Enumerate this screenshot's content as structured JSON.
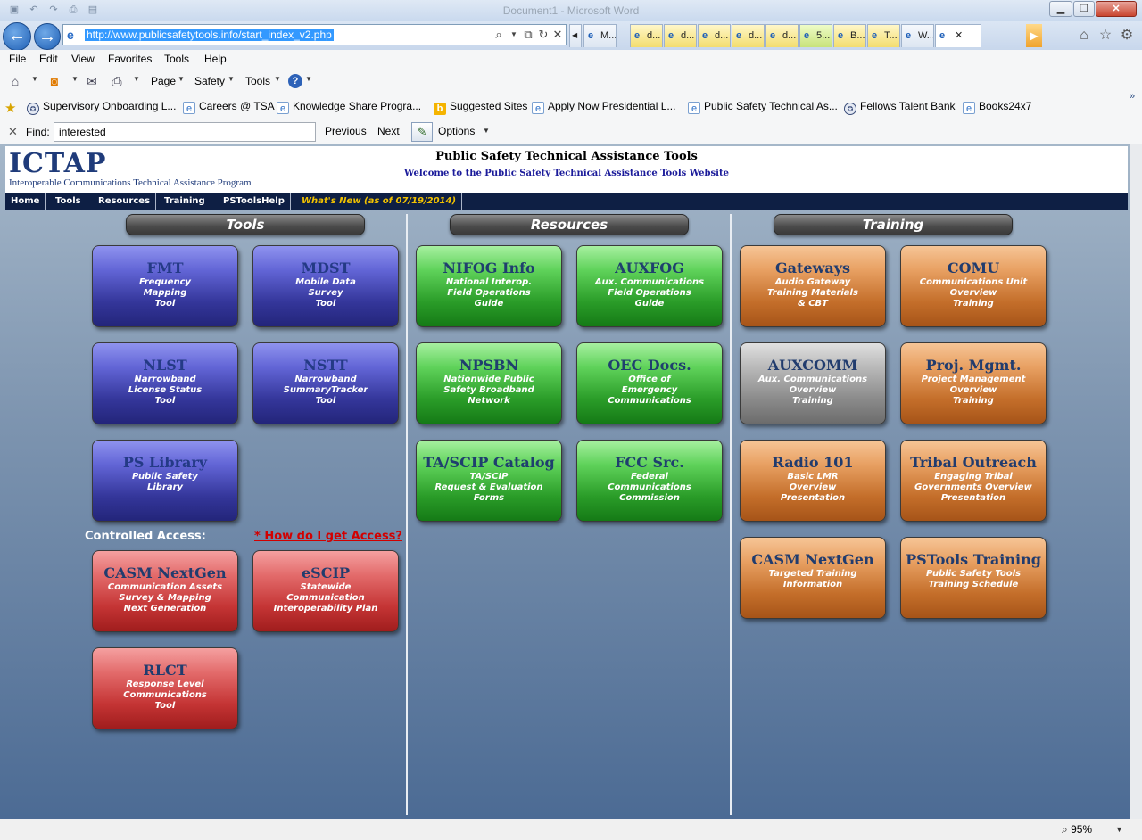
{
  "browser": {
    "window_title": "Document1 - Microsoft Word",
    "address_url": "http://www.publicsafetytools.info/start_index_v2.php",
    "tabs": [
      {
        "label": "M...",
        "style": "n"
      },
      {
        "label": "d...",
        "style": "y"
      },
      {
        "label": "d...",
        "style": "y"
      },
      {
        "label": "d...",
        "style": "y"
      },
      {
        "label": "d...",
        "style": "y"
      },
      {
        "label": "d...",
        "style": "y"
      },
      {
        "label": "5...",
        "style": "g"
      },
      {
        "label": "B...",
        "style": "y"
      },
      {
        "label": "T...",
        "style": "y"
      },
      {
        "label": "W...",
        "style": "n"
      },
      {
        "label": "",
        "style": "active"
      }
    ],
    "menu": [
      "File",
      "Edit",
      "View",
      "Favorites",
      "Tools",
      "Help"
    ],
    "command_bar": {
      "page": "Page",
      "safety": "Safety",
      "tools": "Tools"
    },
    "favorites": [
      {
        "label": "Supervisory Onboarding L...",
        "icon": "seal"
      },
      {
        "label": "Careers @ TSA",
        "icon": "ie"
      },
      {
        "label": "Knowledge Share Progra...",
        "icon": "ie"
      },
      {
        "label": "Suggested Sites",
        "icon": "bing"
      },
      {
        "label": "Apply Now  Presidential L...",
        "icon": "ie"
      },
      {
        "label": "Public Safety Technical As...",
        "icon": "ie"
      },
      {
        "label": "Fellows Talent Bank",
        "icon": "seal"
      },
      {
        "label": "Books24x7",
        "icon": "ie"
      }
    ],
    "find": {
      "label": "Find:",
      "value": "interested",
      "previous": "Previous",
      "next": "Next",
      "options": "Options"
    },
    "zoom": "95%"
  },
  "site": {
    "logo": "ICTAP",
    "logo_sub": "Interoperable Communications Technical Assistance Program",
    "title": "Public Safety Technical Assistance Tools",
    "welcome": "Welcome to the Public Safety Technical Assistance Tools Website",
    "nav": [
      "Home",
      "Tools",
      "Resources",
      "Training",
      "PSToolsHelp"
    ],
    "whats_new": "What's New (as of 07/19/2014)"
  },
  "sections": {
    "tools": "Tools",
    "resources": "Resources",
    "training": "Training"
  },
  "controlled_access": {
    "label": "Controlled Access:",
    "link": "* How do I get Access?"
  },
  "tools": [
    {
      "title": "FMT",
      "desc": "Frequency\nMapping\nTool"
    },
    {
      "title": "MDST",
      "desc": "Mobile Data\nSurvey\nTool"
    },
    {
      "title": "NLST",
      "desc": "Narrowband\nLicense Status\nTool"
    },
    {
      "title": "NSTT",
      "desc": "Narrowband\nSummaryTracker\nTool"
    },
    {
      "title": "PS Library",
      "desc": "Public Safety\nLibrary"
    },
    {
      "title": "CASM NextGen",
      "desc": "Communication Assets\nSurvey & Mapping\nNext Generation"
    },
    {
      "title": "eSCIP",
      "desc": "Statewide\nCommunication\nInteroperability Plan"
    },
    {
      "title": "RLCT",
      "desc": "Response Level\nCommunications\nTool"
    }
  ],
  "resources": [
    {
      "title": "NIFOG Info",
      "desc": "National Interop.\nField Operations\nGuide"
    },
    {
      "title": "AUXFOG",
      "desc": "Aux. Communications\nField Operations\nGuide"
    },
    {
      "title": "NPSBN",
      "desc": "Nationwide Public\nSafety Broadband\nNetwork"
    },
    {
      "title": "OEC Docs.",
      "desc": "Office of\nEmergency\nCommunications"
    },
    {
      "title": "TA/SCIP Catalog",
      "desc": "TA/SCIP\nRequest & Evaluation\nForms"
    },
    {
      "title": "FCC Src.",
      "desc": "Federal\nCommunications\nCommission"
    }
  ],
  "training": [
    {
      "title": "Gateways",
      "desc": "Audio Gateway\nTraining Materials\n& CBT"
    },
    {
      "title": "COMU",
      "desc": "Communications Unit\nOverview\nTraining"
    },
    {
      "title": "AUXCOMM",
      "desc": "Aux. Communications\nOverview\nTraining"
    },
    {
      "title": "Proj. Mgmt.",
      "desc": "Project Management\nOverview\nTraining"
    },
    {
      "title": "Radio 101",
      "desc": "Basic LMR\nOverview\nPresentation"
    },
    {
      "title": "Tribal Outreach",
      "desc": "Engaging Tribal\nGovernments Overview\nPresentation"
    },
    {
      "title": "CASM NextGen",
      "desc": "Targeted Training\nInformation"
    },
    {
      "title": "PSTools Training",
      "desc": "Public Safety Tools\nTraining Schedule"
    }
  ]
}
